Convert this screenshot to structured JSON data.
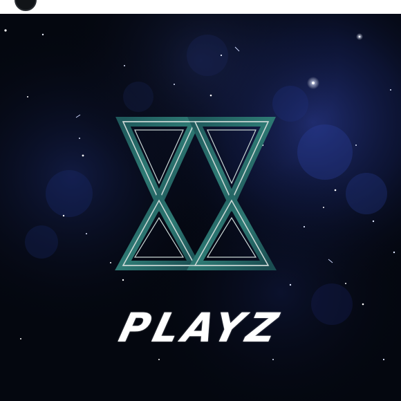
{
  "post": {
    "brand_text": "PLAYZ"
  },
  "colors": {
    "background_dark": "#04070f",
    "nebula_blue": "#1a2a6e",
    "logo_teal": "#2b6e6a",
    "logo_outline": "#c9d6d4",
    "text_white": "#ffffff"
  },
  "icons": {
    "logo": "hourglass-triangles-logo",
    "avatar": "profile-avatar"
  }
}
